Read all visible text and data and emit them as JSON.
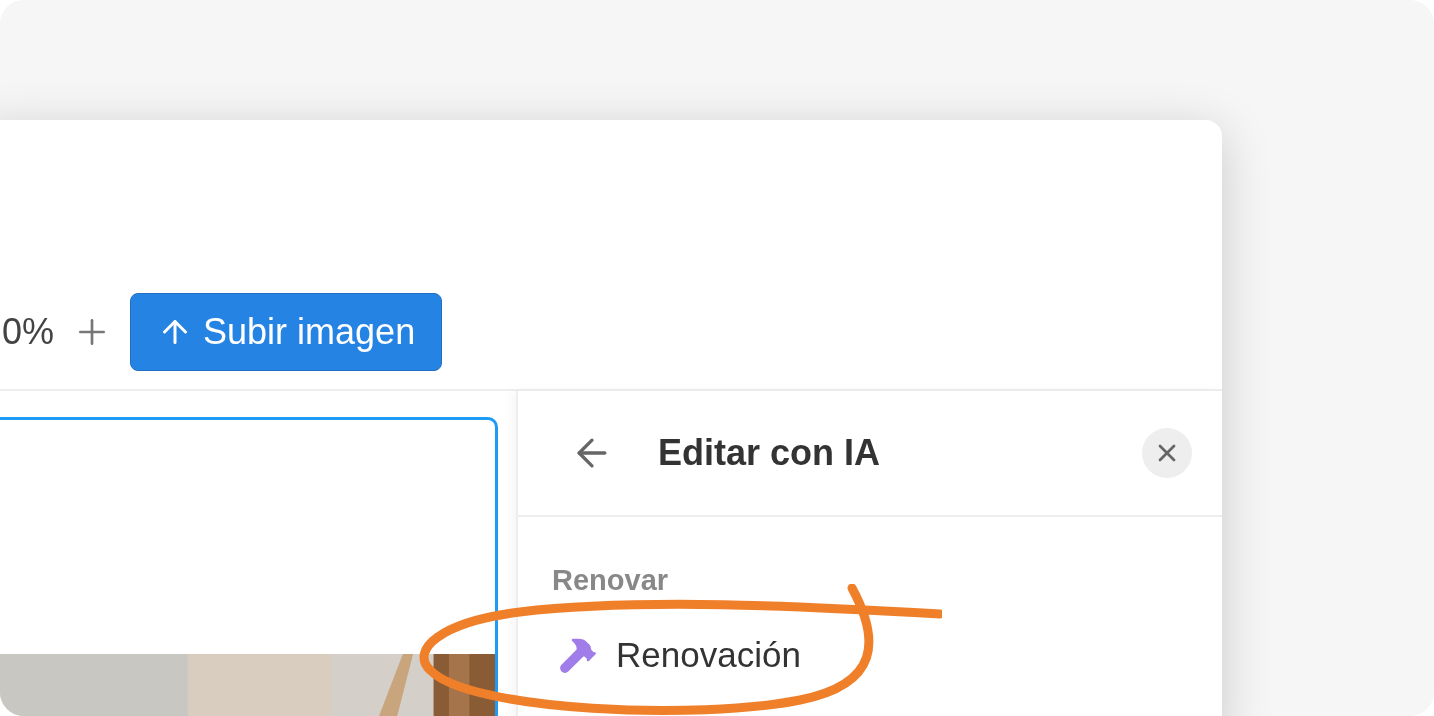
{
  "toolbar": {
    "zoom_text": "0%",
    "upload_button": {
      "label": "Subir imagen"
    }
  },
  "panel": {
    "title": "Editar con IA",
    "section": "Renovar",
    "items": [
      {
        "label": "Renovación"
      }
    ]
  }
}
